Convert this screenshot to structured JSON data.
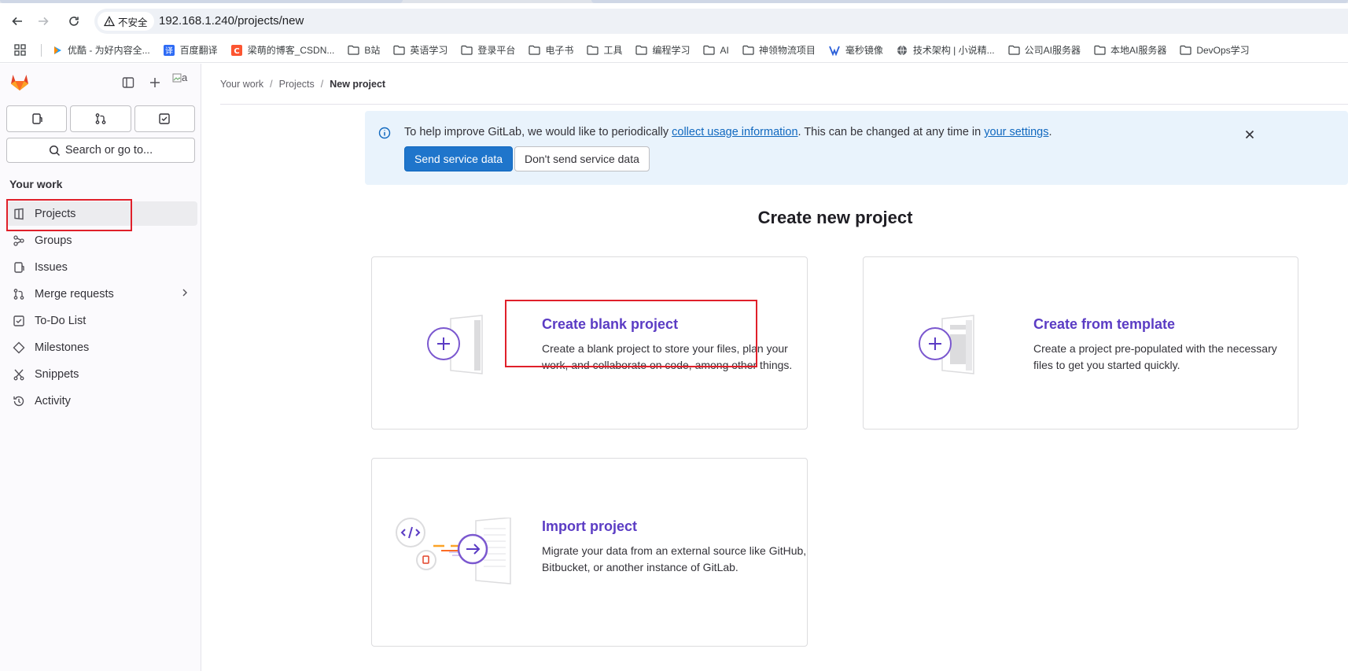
{
  "browser": {
    "security_label": "不安全",
    "url": "192.168.1.240/projects/new",
    "bookmarks": [
      {
        "label": "优酷 - 为好内容全...",
        "icon": "youku-icon"
      },
      {
        "label": "百度翻译",
        "icon": "translate-icon"
      },
      {
        "label": "梁萌的博客_CSDN...",
        "icon": "csdn-icon"
      },
      {
        "label": "B站",
        "icon": "folder-icon"
      },
      {
        "label": "英语学习",
        "icon": "folder-icon"
      },
      {
        "label": "登录平台",
        "icon": "folder-icon"
      },
      {
        "label": "电子书",
        "icon": "folder-icon"
      },
      {
        "label": "工具",
        "icon": "folder-icon"
      },
      {
        "label": "编程学习",
        "icon": "folder-icon"
      },
      {
        "label": "AI",
        "icon": "folder-icon"
      },
      {
        "label": "神领物流项目",
        "icon": "folder-icon"
      },
      {
        "label": "毫秒镜像",
        "icon": "mirror-icon"
      },
      {
        "label": "技术架构 | 小说精...",
        "icon": "globe-icon"
      },
      {
        "label": "公司AI服务器",
        "icon": "folder-icon"
      },
      {
        "label": "本地AI服务器",
        "icon": "folder-icon"
      },
      {
        "label": "DevOps学习",
        "icon": "folder-icon"
      }
    ]
  },
  "sidebar": {
    "avatar_alt": "a",
    "search_label": "Search or go to...",
    "section_title": "Your work",
    "items": [
      {
        "label": "Projects",
        "icon": "project-icon",
        "active": true
      },
      {
        "label": "Groups",
        "icon": "group-icon"
      },
      {
        "label": "Issues",
        "icon": "issues-icon"
      },
      {
        "label": "Merge requests",
        "icon": "merge-request-icon",
        "has_chevron": true
      },
      {
        "label": "To-Do List",
        "icon": "todo-icon"
      },
      {
        "label": "Milestones",
        "icon": "milestone-icon"
      },
      {
        "label": "Snippets",
        "icon": "snippet-icon"
      },
      {
        "label": "Activity",
        "icon": "activity-icon"
      }
    ]
  },
  "breadcrumb": {
    "items": [
      "Your work",
      "Projects"
    ],
    "current": "New project"
  },
  "alert": {
    "text_before": "To help improve GitLab, we would like to periodically ",
    "link1": "collect usage information",
    "text_middle": ". This can be changed at any time in ",
    "link2": "your settings",
    "text_after": ".",
    "primary_button": "Send service data",
    "secondary_button": "Don't send service data"
  },
  "page": {
    "title": "Create new project"
  },
  "cards": {
    "blank": {
      "title": "Create blank project",
      "desc_line1": "Create a blank project to store your files, plan your",
      "desc_line2": "work, and collaborate on code, among other things."
    },
    "template": {
      "title": "Create from template",
      "desc_line1": "Create a project pre-populated with the necessary",
      "desc_line2": "files to get you started quickly."
    },
    "import": {
      "title": "Import project",
      "desc_line1": "Migrate your data from an external source like GitHub,",
      "desc_line2": "Bitbucket, or another instance of GitLab."
    }
  },
  "colors": {
    "accent_purple": "#5b3cc4",
    "primary_blue": "#1f75cb",
    "alert_bg": "#e9f3fc",
    "annotation_red": "#e0202a",
    "gitlab_orange": "#e24329"
  }
}
